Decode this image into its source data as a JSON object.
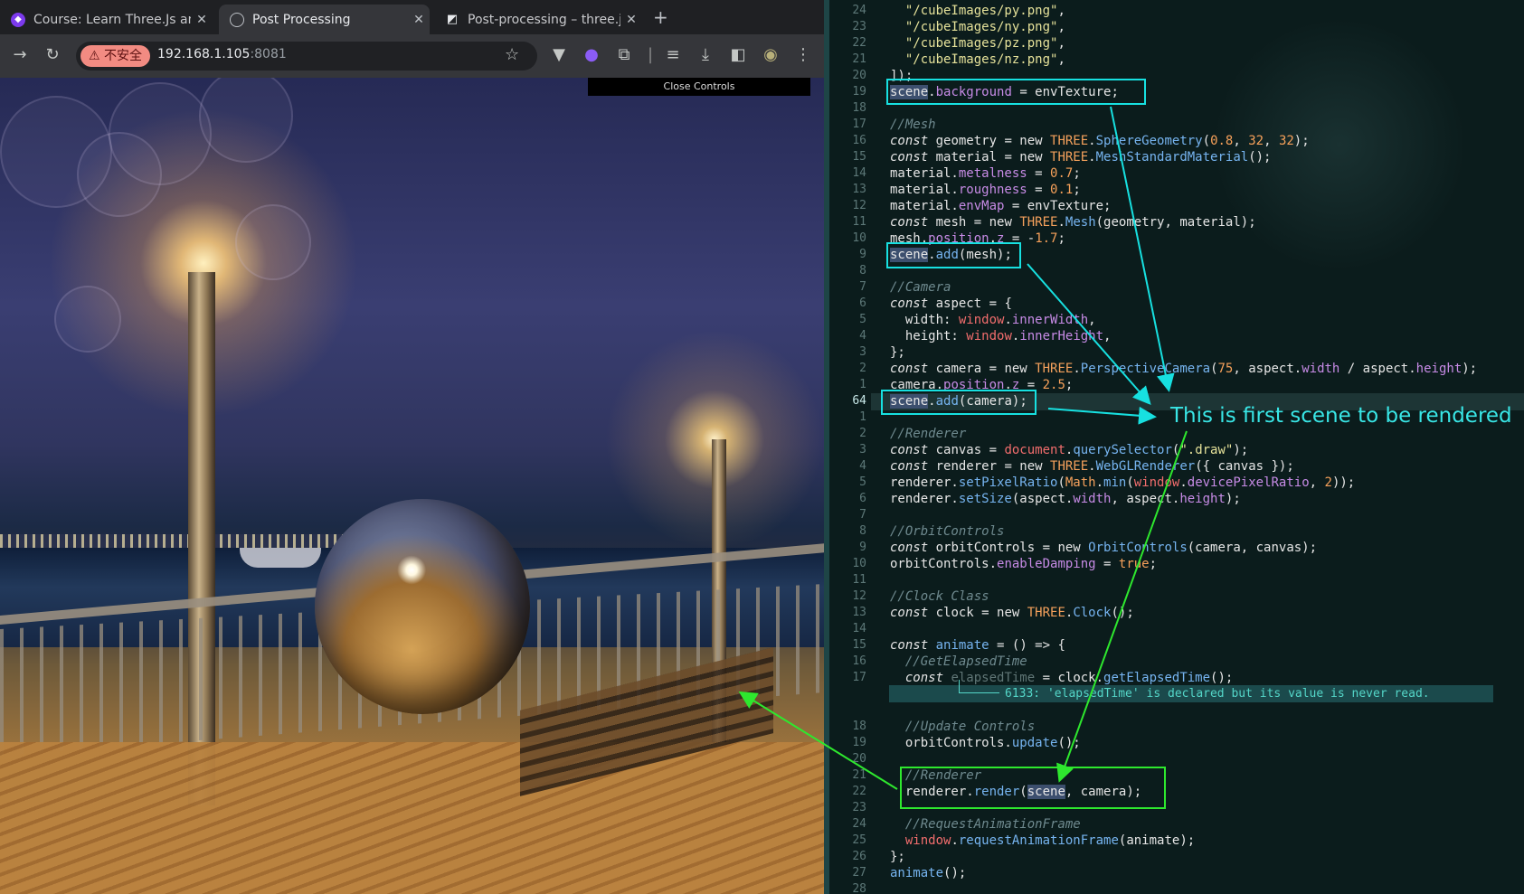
{
  "browser": {
    "tabs": [
      {
        "title": "Course: Learn Three.Js and",
        "favicon": "course-icon",
        "color": "#8b5cf6"
      },
      {
        "title": "Post Processing",
        "favicon": "globe-icon",
        "color": "#5f6368"
      },
      {
        "title": "Post-processing – three.js",
        "favicon": "threejs-icon",
        "color": "#2d2d2d"
      }
    ],
    "newtab_label": "+",
    "tab_close": "✕",
    "security_warning": "⚠ 不安全",
    "url_host": "192.168.1.105",
    "url_port": ":8081"
  },
  "viewport": {
    "close_controls": "Close Controls"
  },
  "editor": {
    "line_numbers": [
      "24",
      "23",
      "22",
      "21",
      "20",
      "19",
      "18",
      "17",
      "16",
      "15",
      "14",
      "13",
      "12",
      "11",
      "10",
      "9",
      "8",
      "7",
      "6",
      "5",
      "4",
      "3",
      "2",
      "1",
      "64",
      "1",
      "2",
      "3",
      "4",
      "5",
      "6",
      "7",
      "8",
      "9",
      "10",
      "11",
      "12",
      "13",
      "14",
      "15",
      "16",
      "17",
      "",
      "18",
      "19",
      "20",
      "21",
      "22",
      "23",
      "24",
      "25",
      "26",
      "27",
      "28"
    ],
    "current_line": "64",
    "diagnostic": "6133: 'elapsedTime' is declared but its value is never read."
  },
  "annotation": {
    "text": "This is first scene to be rendered",
    "colors": {
      "cyan": "#17e0e0",
      "green": "#2ee82e"
    }
  }
}
